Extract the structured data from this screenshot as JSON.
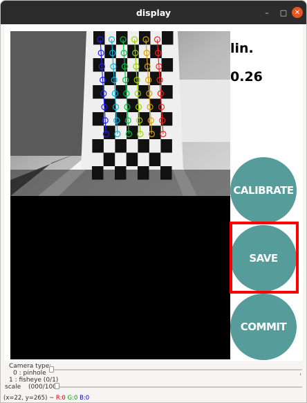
{
  "window": {
    "title": "display"
  },
  "titlebar_icons": {
    "minimize": "minimize-icon",
    "maximize": "maximize-icon",
    "close": "close-icon"
  },
  "sidebar": {
    "mode": "lin.",
    "value": "0.26"
  },
  "buttons": {
    "calibrate": "CALIBRATE",
    "save": "SAVE",
    "commit": "COMMIT"
  },
  "controls": {
    "camera_type_label": "Camera type:",
    "camera_type_option0": "0 : pinhole",
    "camera_type_option1": "1 : fisheye (0/1)",
    "camera_type_value": 0,
    "scale_label": "scale",
    "scale_value": "(000/100)"
  },
  "status": {
    "coords": "(x=22, y=265) ~",
    "r": "R:0",
    "g": "G:0",
    "b": "B:0"
  },
  "colors": {
    "button": "#559c9a",
    "highlight": "#ff0000",
    "titlebar": "#2c2c2c",
    "close": "#e95420"
  }
}
